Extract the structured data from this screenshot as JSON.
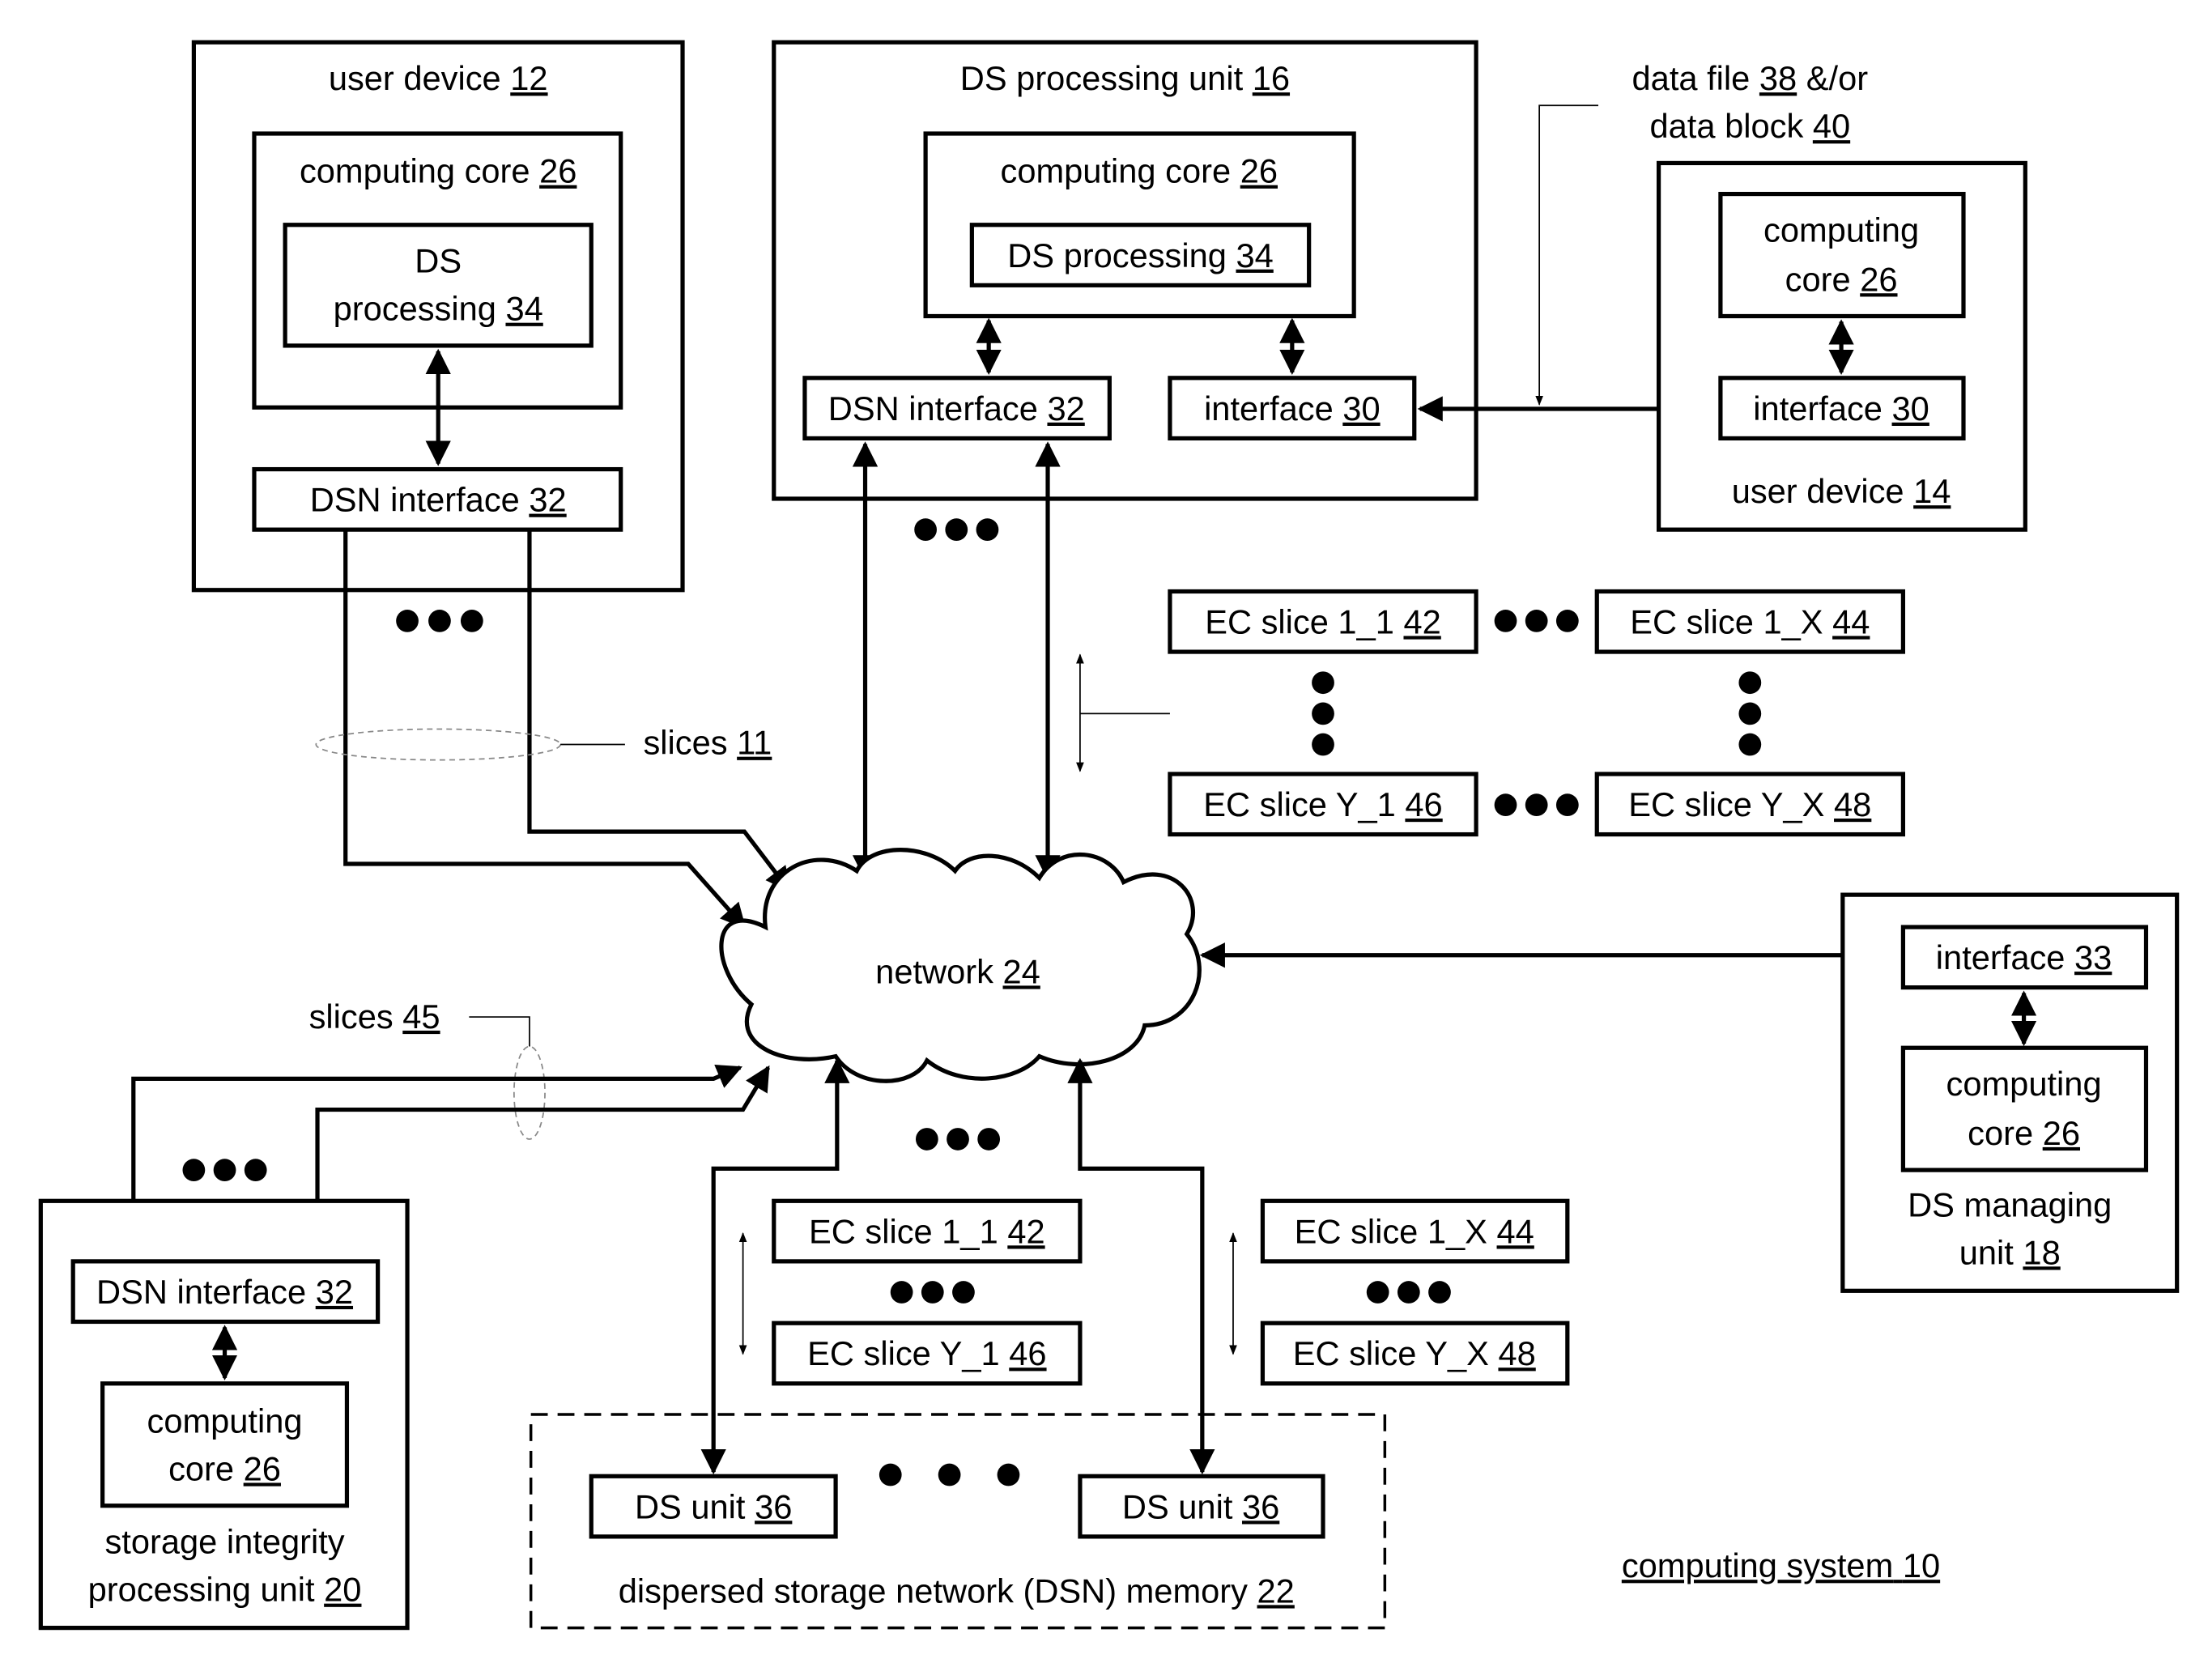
{
  "user_device_12": {
    "title": "user device",
    "title_ref": "12",
    "core": "computing core",
    "core_ref": "26",
    "ds_proc_line1": "DS",
    "ds_proc_line2": "processing",
    "ds_proc_ref": "34",
    "dsn_if": "DSN interface",
    "dsn_if_ref": "32"
  },
  "ds_processing_unit_16": {
    "title": "DS processing unit",
    "title_ref": "16",
    "core": "computing core",
    "core_ref": "26",
    "ds_proc": "DS processing",
    "ds_proc_ref": "34",
    "dsn_if": "DSN interface",
    "dsn_if_ref": "32",
    "iface": "interface",
    "iface_ref": "30"
  },
  "data_label": {
    "line1": "data file",
    "ref1": "38",
    "line1_suffix": "&/or",
    "line2": "data block",
    "ref2": "40"
  },
  "user_device_14": {
    "core_line1": "computing",
    "core_line2": "core",
    "core_ref": "26",
    "iface": "interface",
    "iface_ref": "30",
    "title": "user device",
    "title_ref": "14"
  },
  "ec_grid": {
    "s11": "EC slice 1_1",
    "s11_ref": "42",
    "s1x": "EC slice 1_X",
    "s1x_ref": "44",
    "sy1": "EC slice Y_1",
    "sy1_ref": "46",
    "syx": "EC slice Y_X",
    "syx_ref": "48"
  },
  "slices_11": {
    "label": "slices",
    "ref": "11"
  },
  "slices_45": {
    "label": "slices",
    "ref": "45"
  },
  "network": {
    "label": "network",
    "ref": "24"
  },
  "ds_managing_unit_18": {
    "iface": "interface",
    "iface_ref": "33",
    "core_line1": "computing",
    "core_line2": "core",
    "core_ref": "26",
    "title_line1": "DS managing",
    "title_line2": "unit",
    "title_ref": "18"
  },
  "storage_integrity_20": {
    "dsn_if": "DSN interface",
    "dsn_if_ref": "32",
    "core_line1": "computing",
    "core_line2": "core",
    "core_ref": "26",
    "title_line1": "storage integrity",
    "title_line2": "processing unit",
    "title_ref": "20"
  },
  "dsn_memory_22": {
    "unit": "DS unit",
    "unit_ref": "36",
    "title": "dispersed storage network (DSN) memory",
    "title_ref": "22",
    "left_s11": "EC slice 1_1",
    "left_s11_ref": "42",
    "left_sy1": "EC slice Y_1",
    "left_sy1_ref": "46",
    "right_s1x": "EC slice 1_X",
    "right_s1x_ref": "44",
    "right_syx": "EC slice Y_X",
    "right_syx_ref": "48"
  },
  "system_label": {
    "label": "computing system",
    "ref": "10"
  }
}
